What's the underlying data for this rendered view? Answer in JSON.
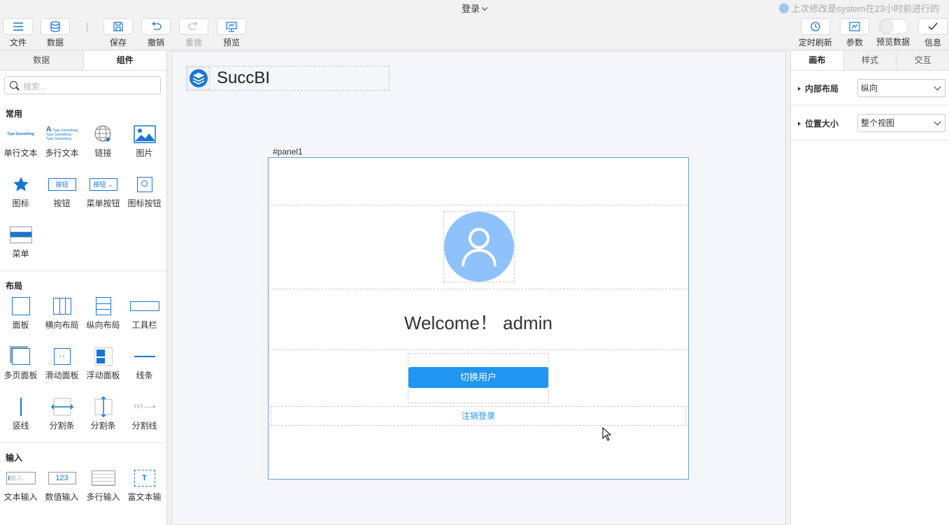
{
  "header": {
    "title": "登录",
    "last_modified": "上次修改是system在23小时前进行的"
  },
  "toolbar": {
    "file": "文件",
    "data": "数据",
    "save": "保存",
    "undo": "撤销",
    "redo": "重做",
    "preview": "预览",
    "timed_refresh": "定时刷新",
    "params": "参数",
    "preview_data": "预览数据",
    "info": "信息"
  },
  "left_panel": {
    "tabs": [
      "数据",
      "组件"
    ],
    "active_tab": "组件",
    "search_placeholder": "搜索...",
    "sections": [
      {
        "title": "常用",
        "items": [
          "单行文本",
          "多行文本",
          "链接",
          "图片",
          "图标",
          "按钮",
          "菜单按钮",
          "图标按钮",
          "菜单"
        ]
      },
      {
        "title": "布局",
        "items": [
          "面板",
          "横向布局",
          "纵向布局",
          "工具栏",
          "多页面板",
          "滑动面板",
          "浮动面板",
          "线条",
          "竖线",
          "分割条",
          "分割条",
          "分割线"
        ]
      },
      {
        "title": "输入",
        "items": [
          "文本输入",
          "数值输入",
          "多行输入",
          "富文本输"
        ]
      }
    ],
    "icon_texts": {
      "type_something": "Type Something",
      "button": "按钮",
      "input": "输入...",
      "number": "123",
      "txt": "TXT"
    }
  },
  "canvas": {
    "logo_text": "SuccBI",
    "panel_label": "#panel1",
    "welcome": "Welcome！ admin",
    "switch_user": "切换用户",
    "logout": "注销登录"
  },
  "right_panel": {
    "tabs": [
      "画布",
      "样式",
      "交互"
    ],
    "active_tab": "画布",
    "props": [
      {
        "label": "内部布局",
        "value": "纵向"
      },
      {
        "label": "位置大小",
        "value": "整个视图"
      }
    ]
  },
  "colors": {
    "accent": "#2196f3",
    "avatar_bg": "#8fc2fb",
    "panel_border": "#6c9ed6"
  }
}
